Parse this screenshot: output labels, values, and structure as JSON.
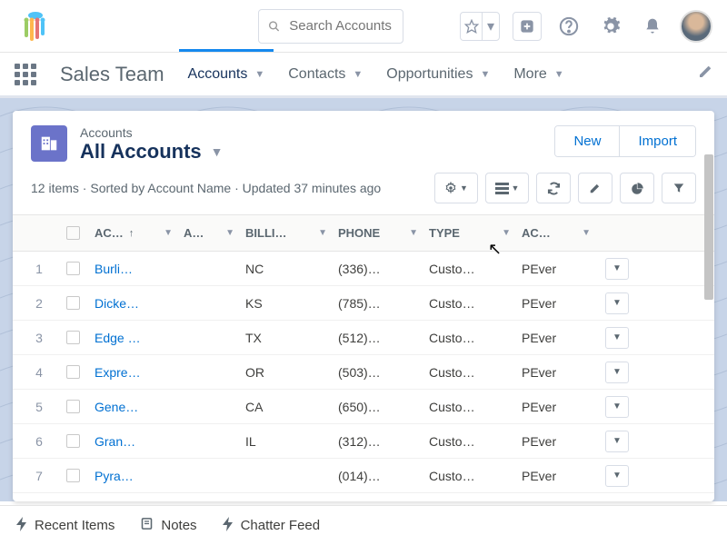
{
  "search": {
    "placeholder": "Search Accounts"
  },
  "app": {
    "name": "Sales Team"
  },
  "nav": [
    {
      "label": "Accounts",
      "active": true
    },
    {
      "label": "Contacts",
      "active": false
    },
    {
      "label": "Opportunities",
      "active": false
    },
    {
      "label": "More",
      "active": false
    }
  ],
  "header": {
    "objectLabel": "Accounts",
    "viewTitle": "All Accounts",
    "newLabel": "New",
    "importLabel": "Import",
    "subtext": "12 items · Sorted by Account Name · Updated 37 minutes ago"
  },
  "columns": {
    "name": "AC…",
    "extra": "A…",
    "billing": "BILLI…",
    "phone": "PHONE",
    "type": "TYPE",
    "owner": "AC…"
  },
  "rows": [
    {
      "n": "1",
      "name": "Burli…",
      "billing": "NC",
      "phone": "(336)…",
      "type": "Custo…",
      "owner": "PEver"
    },
    {
      "n": "2",
      "name": "Dicke…",
      "billing": "KS",
      "phone": "(785)…",
      "type": "Custo…",
      "owner": "PEver"
    },
    {
      "n": "3",
      "name": "Edge …",
      "billing": "TX",
      "phone": "(512)…",
      "type": "Custo…",
      "owner": "PEver"
    },
    {
      "n": "4",
      "name": "Expre…",
      "billing": "OR",
      "phone": "(503)…",
      "type": "Custo…",
      "owner": "PEver"
    },
    {
      "n": "5",
      "name": "Gene…",
      "billing": "CA",
      "phone": "(650)…",
      "type": "Custo…",
      "owner": "PEver"
    },
    {
      "n": "6",
      "name": "Gran…",
      "billing": "IL",
      "phone": "(312)…",
      "type": "Custo…",
      "owner": "PEver"
    },
    {
      "n": "7",
      "name": "Pyra…",
      "billing": "",
      "phone": "(014)…",
      "type": "Custo…",
      "owner": "PEver"
    }
  ],
  "footer": {
    "recent": "Recent Items",
    "notes": "Notes",
    "chatter": "Chatter Feed"
  }
}
